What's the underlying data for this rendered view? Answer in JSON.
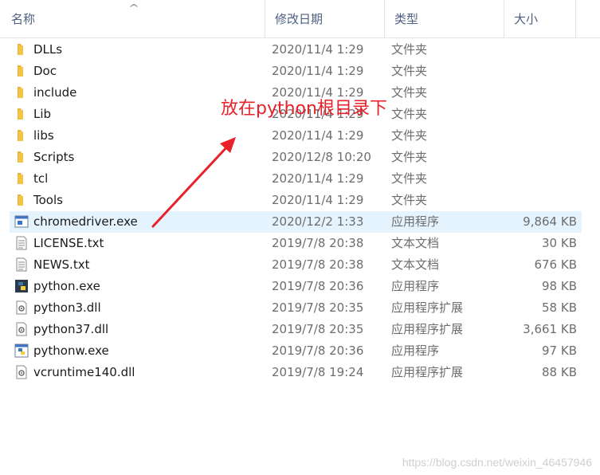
{
  "columns": {
    "name": "名称",
    "date": "修改日期",
    "type": "类型",
    "size": "大小"
  },
  "files": [
    {
      "name": "DLLs",
      "date": "2020/11/4 1:29",
      "type": "文件夹",
      "size": "",
      "icon": "folder-icon"
    },
    {
      "name": "Doc",
      "date": "2020/11/4 1:29",
      "type": "文件夹",
      "size": "",
      "icon": "folder-icon"
    },
    {
      "name": "include",
      "date": "2020/11/4 1:29",
      "type": "文件夹",
      "size": "",
      "icon": "folder-icon"
    },
    {
      "name": "Lib",
      "date": "2020/11/4 1:29",
      "type": "文件夹",
      "size": "",
      "icon": "folder-icon"
    },
    {
      "name": "libs",
      "date": "2020/11/4 1:29",
      "type": "文件夹",
      "size": "",
      "icon": "folder-icon"
    },
    {
      "name": "Scripts",
      "date": "2020/12/8 10:20",
      "type": "文件夹",
      "size": "",
      "icon": "folder-icon"
    },
    {
      "name": "tcl",
      "date": "2020/11/4 1:29",
      "type": "文件夹",
      "size": "",
      "icon": "folder-icon"
    },
    {
      "name": "Tools",
      "date": "2020/11/4 1:29",
      "type": "文件夹",
      "size": "",
      "icon": "folder-icon"
    },
    {
      "name": "chromedriver.exe",
      "date": "2020/12/2 1:33",
      "type": "应用程序",
      "size": "9,864 KB",
      "icon": "exe-icon",
      "selected": true
    },
    {
      "name": "LICENSE.txt",
      "date": "2019/7/8 20:38",
      "type": "文本文档",
      "size": "30 KB",
      "icon": "text-file-icon"
    },
    {
      "name": "NEWS.txt",
      "date": "2019/7/8 20:38",
      "type": "文本文档",
      "size": "676 KB",
      "icon": "text-file-icon"
    },
    {
      "name": "python.exe",
      "date": "2019/7/8 20:36",
      "type": "应用程序",
      "size": "98 KB",
      "icon": "python-icon"
    },
    {
      "name": "python3.dll",
      "date": "2019/7/8 20:35",
      "type": "应用程序扩展",
      "size": "58 KB",
      "icon": "dll-icon"
    },
    {
      "name": "python37.dll",
      "date": "2019/7/8 20:35",
      "type": "应用程序扩展",
      "size": "3,661 KB",
      "icon": "dll-icon"
    },
    {
      "name": "pythonw.exe",
      "date": "2019/7/8 20:36",
      "type": "应用程序",
      "size": "97 KB",
      "icon": "pythonw-icon"
    },
    {
      "name": "vcruntime140.dll",
      "date": "2019/7/8 19:24",
      "type": "应用程序扩展",
      "size": "88 KB",
      "icon": "dll-icon"
    }
  ],
  "annotation": "放在python根目录下",
  "watermark": "https://blog.csdn.net/weixin_46457946",
  "colors": {
    "header_text": "#4d6082",
    "selected_row": "#e5f3ff",
    "annotation": "#e8212a",
    "folder": "#f4c542"
  }
}
